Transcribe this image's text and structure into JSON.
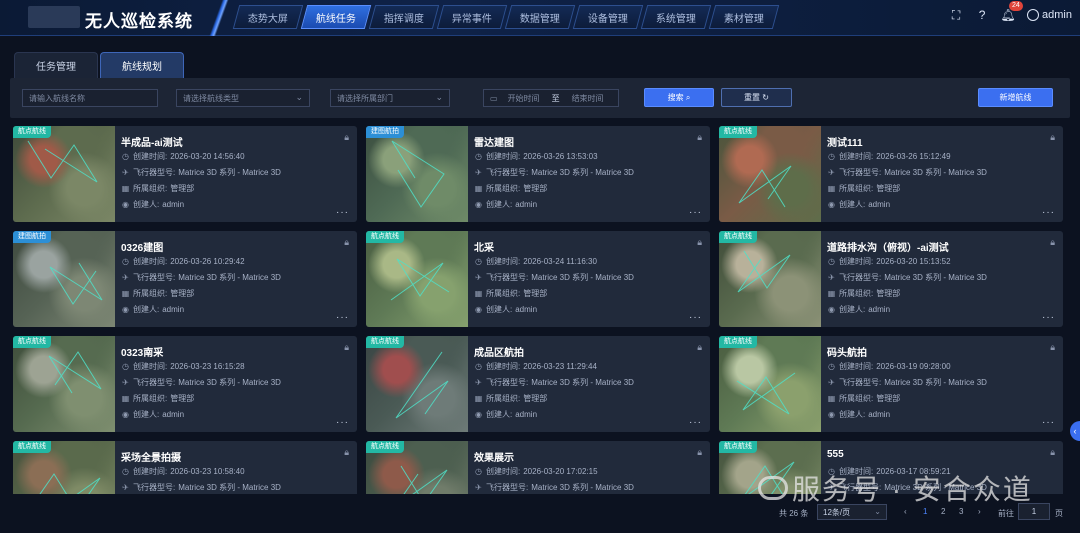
{
  "app": {
    "title": "无人巡检系统"
  },
  "nav": [
    "态势大屏",
    "航线任务",
    "指挥调度",
    "异常事件",
    "数据管理",
    "设备管理",
    "系统管理",
    "素材管理"
  ],
  "nav_active_index": 1,
  "header": {
    "notification_count": "24",
    "username": "admin"
  },
  "subtabs": [
    "任务管理",
    "航线规划"
  ],
  "subtab_active_index": 1,
  "filters": {
    "name_placeholder": "请输入航线名称",
    "type_placeholder": "请选择航线类型",
    "dept_placeholder": "请选择所属部门",
    "start_placeholder": "开始时间",
    "range_sep": "至",
    "end_placeholder": "结束时间",
    "search_label": "搜索",
    "reset_label": "重置",
    "add_label": "新增航线"
  },
  "card_labels": {
    "created_time": "创建时间:",
    "aircraft": "飞行器型号:",
    "org": "所属组织:",
    "creator": "创建人:"
  },
  "routes": [
    {
      "tag": "航点航线",
      "title": "半成品-ai测试",
      "created": "2026-03-20 14:56:40",
      "aircraft": "Matrice 3D 系列 - Matrice 3D",
      "org": "管理部",
      "creator": "admin"
    },
    {
      "tag": "建图航拍",
      "title": "雷达建图",
      "created": "2026-03-26 13:53:03",
      "aircraft": "Matrice 3D 系列 - Matrice 3D",
      "org": "管理部",
      "creator": "admin"
    },
    {
      "tag": "航点航线",
      "title": "测试111",
      "created": "2026-03-26 15:12:49",
      "aircraft": "Matrice 3D 系列 - Matrice 3D",
      "org": "管理部",
      "creator": "admin"
    },
    {
      "tag": "建图航拍",
      "title": "0326建图",
      "created": "2026-03-26 10:29:42",
      "aircraft": "Matrice 3D 系列 - Matrice 3D",
      "org": "管理部",
      "creator": "admin"
    },
    {
      "tag": "航点航线",
      "title": "北采",
      "created": "2026-03-24 11:16:30",
      "aircraft": "Matrice 3D 系列 - Matrice 3D",
      "org": "管理部",
      "creator": "admin"
    },
    {
      "tag": "航点航线",
      "title": "道路排水沟（俯视）-ai测试",
      "created": "2026-03-20 15:13:52",
      "aircraft": "Matrice 3D 系列 - Matrice 3D",
      "org": "管理部",
      "creator": "admin"
    },
    {
      "tag": "航点航线",
      "title": "0323南采",
      "created": "2026-03-23 16:15:28",
      "aircraft": "Matrice 3D 系列 - Matrice 3D",
      "org": "管理部",
      "creator": "admin"
    },
    {
      "tag": "航点航线",
      "title": "成品区航拍",
      "created": "2026-03-23 11:29:44",
      "aircraft": "Matrice 3D 系列 - Matrice 3D",
      "org": "管理部",
      "creator": "admin"
    },
    {
      "tag": "航点航线",
      "title": "码头航拍",
      "created": "2026-03-19 09:28:00",
      "aircraft": "Matrice 3D 系列 - Matrice 3D",
      "org": "管理部",
      "creator": "admin"
    },
    {
      "tag": "航点航线",
      "title": "采场全景拍摄",
      "created": "2026-03-23 10:58:40",
      "aircraft": "Matrice 3D 系列 - Matrice 3D",
      "org": "",
      "creator": ""
    },
    {
      "tag": "航点航线",
      "title": "效果展示",
      "created": "2026-03-20 17:02:15",
      "aircraft": "Matrice 3D 系列 - Matrice 3D",
      "org": "",
      "creator": ""
    },
    {
      "tag": "航点航线",
      "title": "555",
      "created": "2026-03-17 08:59:21",
      "aircraft": "Matrice 3D 系列 - Matrice 3D",
      "org": "",
      "creator": ""
    }
  ],
  "pagination": {
    "total": "共 26 条",
    "page_size": "12条/页",
    "prev": "‹",
    "pages": [
      "1",
      "2",
      "3"
    ],
    "current": "1",
    "next": "›",
    "goto_label": "前往",
    "goto_value": "1",
    "page_suffix": "页"
  },
  "watermark": {
    "text": "服务号 · 安合众道"
  },
  "colors": {
    "accent": "#3b6ff0",
    "tag_teal": "#23b8a4",
    "tag_blue": "#2c8fd6",
    "card_bg": "#212a3b"
  }
}
